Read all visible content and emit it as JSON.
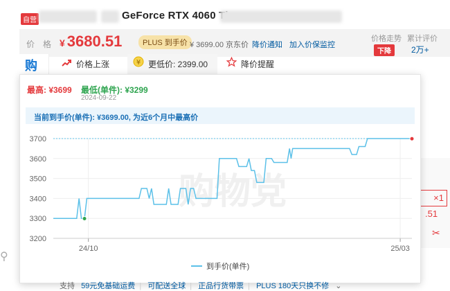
{
  "header": {
    "self_badge": "自营",
    "product_title": "GeForce RTX 4060 Ti"
  },
  "price": {
    "label": "价格",
    "currency": "¥",
    "current": "3680.51",
    "plus_tag": "PLUS 到手价",
    "jd_price": "¥ 3699.00 京东价",
    "notify_label": "降价通知",
    "monitor_label": "加入价保监控",
    "trend_label": "价格走势",
    "trend_badge": "下降",
    "eval_label": "累计评价",
    "eval_count": "2万+"
  },
  "tools": {
    "logo_glyph": "购",
    "rise_label": "价格上涨",
    "low_label": "更低价: 2399.00",
    "alert_label": "降价提醒"
  },
  "history": {
    "max_text": "最高: ¥3699",
    "min_text": "最低(单件): ¥3299",
    "min_date": "2024-09-22",
    "note": "当前到手价(单件): ¥3699.00, 为近6个月中最高价",
    "watermark": "购物党"
  },
  "chart_data": {
    "type": "line",
    "series": [
      {
        "name": "到手价(单件)",
        "color": "#5bc0e8",
        "points": [
          [
            0,
            3300
          ],
          [
            2,
            3300
          ],
          [
            3,
            3300
          ],
          [
            3.3,
            3400
          ],
          [
            3.6,
            3300
          ],
          [
            4,
            3300
          ],
          [
            4.3,
            3400
          ],
          [
            6,
            3400
          ],
          [
            10,
            3400
          ],
          [
            11,
            3400
          ],
          [
            11.3,
            3450
          ],
          [
            12,
            3450
          ],
          [
            12.3,
            3400
          ],
          [
            12.6,
            3450
          ],
          [
            12.9,
            3370
          ],
          [
            14.5,
            3370
          ],
          [
            14.8,
            3450
          ],
          [
            15.1,
            3370
          ],
          [
            16,
            3370
          ],
          [
            16.3,
            3450
          ],
          [
            17,
            3450
          ],
          [
            17.3,
            3370
          ],
          [
            17.6,
            3450
          ],
          [
            18,
            3450
          ],
          [
            18.3,
            3400
          ],
          [
            20,
            3400
          ],
          [
            21,
            3400
          ],
          [
            21.3,
            3600
          ],
          [
            23.5,
            3600
          ],
          [
            23.8,
            3560
          ],
          [
            24.8,
            3560
          ],
          [
            25.1,
            3600
          ],
          [
            25.4,
            3540
          ],
          [
            25.8,
            3540
          ],
          [
            26.1,
            3480
          ],
          [
            27,
            3480
          ],
          [
            27.3,
            3600
          ],
          [
            28,
            3600
          ],
          [
            28.3,
            3580
          ],
          [
            30,
            3580
          ],
          [
            30.3,
            3650
          ],
          [
            30.5,
            3600
          ],
          [
            30.7,
            3650
          ],
          [
            32,
            3650
          ],
          [
            36,
            3650
          ],
          [
            38,
            3650
          ],
          [
            38.3,
            3620
          ],
          [
            38.9,
            3620
          ],
          [
            39.2,
            3660
          ],
          [
            40,
            3660
          ],
          [
            40.3,
            3700
          ],
          [
            44,
            3700
          ],
          [
            46,
            3700
          ]
        ]
      }
    ],
    "x_tick_labels": [
      "24/10",
      "25/03"
    ],
    "x_tick_positions": [
      4.5,
      44.5
    ],
    "x_range": [
      0,
      46
    ],
    "y_ticks": [
      3200,
      3300,
      3400,
      3500,
      3600,
      3700
    ],
    "ylim": [
      3200,
      3700
    ],
    "max_value": 3699,
    "min_value": 3299,
    "reference_line": 3700,
    "grid": true,
    "legend_position": "bottom"
  },
  "side": {
    "qty_text": "×1",
    "price_fragment": ".51"
  },
  "footer": {
    "support_label": "支持",
    "items": [
      "59元免基础运费",
      "可配送全球",
      "正品行货带票",
      "PLUS 180天只换不修"
    ]
  },
  "colors": {
    "accent_red": "#e4393c",
    "link_blue": "#005aa0",
    "line_blue": "#5bc0e8",
    "min_green": "#2ea44f"
  }
}
